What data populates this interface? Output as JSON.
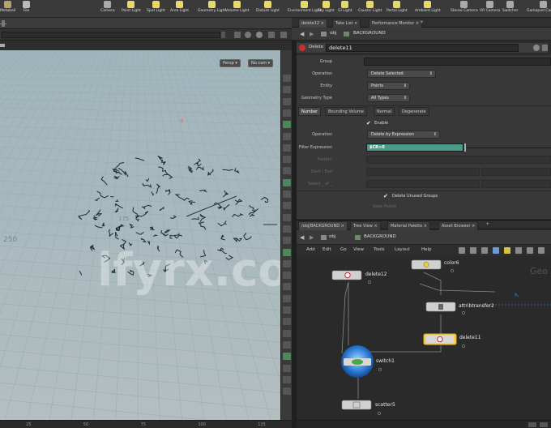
{
  "shelf": {
    "tools": [
      {
        "label": "Metaball",
        "color": "#b5a36a"
      },
      {
        "label": "File",
        "color": "#bbb"
      },
      {
        "label": "Camera",
        "color": "#aaa"
      },
      {
        "label": "Point Light",
        "color": "#e8d76a"
      },
      {
        "label": "Spot Light",
        "color": "#e8d76a"
      },
      {
        "label": "Area Light",
        "color": "#e8d76a"
      },
      {
        "label": "Geometry Light",
        "color": "#e8d76a"
      },
      {
        "label": "Volume Light",
        "color": "#e8d76a"
      },
      {
        "label": "Distant Light",
        "color": "#e8d76a"
      },
      {
        "label": "Environment Light",
        "color": "#e8d76a"
      },
      {
        "label": "Sky Light",
        "color": "#e8d76a"
      },
      {
        "label": "GI Light",
        "color": "#e8d76a"
      },
      {
        "label": "Caustic Light",
        "color": "#e8d76a"
      },
      {
        "label": "Portal Light",
        "color": "#e8d76a"
      },
      {
        "label": "Ambient Light",
        "color": "#e8d76a"
      },
      {
        "label": "Stereo Camera",
        "color": "#aaa"
      },
      {
        "label": "VR Camera",
        "color": "#aaa"
      },
      {
        "label": "Switcher",
        "color": "#aaa"
      },
      {
        "label": "Gamepad Camera",
        "color": "#aaa"
      }
    ]
  },
  "viewport": {
    "persp_label": "Persp",
    "cam_label": "No cam",
    "axis_label": "250",
    "ruler_label": "175",
    "bottom_ticks": [
      "25",
      "50",
      "75",
      "100",
      "125"
    ],
    "grid_color": "#9aaeb0"
  },
  "params": {
    "tabs": [
      "delete12",
      "Take List",
      "Performance Monitor"
    ],
    "path": [
      "obj",
      "BACKGROUND"
    ],
    "node_type": "Delete",
    "node_name": "delete11",
    "group_label": "Group",
    "group_value": "",
    "operation_label": "Operation",
    "operation_value": "Delete Selected",
    "entity_label": "Entity",
    "entity_value": "Points",
    "geometry_type_label": "Geometry Type",
    "geometry_type_value": "All Types",
    "sub_tabs": [
      "Number",
      "Bounding Volume",
      "Normal",
      "Degenerate"
    ],
    "enable_label": "Enable",
    "operation2_label": "Operation",
    "operation2_value": "Delete by Expression",
    "filter_label": "Filter Expression",
    "filter_value": "$CR>0",
    "pattern_label": "Pattern",
    "start_end_label": "Start / End",
    "select_label": "Select _ of _",
    "delete_unused_label": "Delete Unused Groups",
    "keep_points_label": "Keep Points",
    "accent": "#4a9a8a"
  },
  "network": {
    "tabs": [
      "/obj/BACKGROUND",
      "Tree View",
      "Material Palette",
      "Asset Browser"
    ],
    "path": [
      "obj",
      "BACKGROUND"
    ],
    "menu": [
      "Add",
      "Edit",
      "Go",
      "View",
      "Tools",
      "Layout",
      "Help"
    ],
    "context_label": "Geo",
    "nodes": [
      {
        "name": "color6",
        "kind": "color"
      },
      {
        "name": "delete12",
        "kind": "delete"
      },
      {
        "name": "attribtransfer2",
        "kind": "attrib"
      },
      {
        "name": "delete11",
        "kind": "delete-selected"
      },
      {
        "name": "switch1",
        "kind": "switch"
      },
      {
        "name": "scatter5",
        "kind": "scatter"
      }
    ]
  },
  "watermark": "lfyrx.com"
}
